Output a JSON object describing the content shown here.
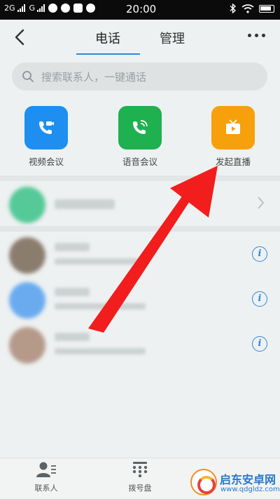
{
  "status_bar": {
    "network1": "2G",
    "network2": "G",
    "time": "20:00"
  },
  "header": {
    "tabs": [
      {
        "label": "电话",
        "active": true
      },
      {
        "label": "管理",
        "active": false
      }
    ],
    "accent_color": "#2c88d8"
  },
  "search": {
    "placeholder": "搜索联系人，一键通话"
  },
  "quick_actions": [
    {
      "label": "视频会议",
      "icon": "video-call-icon",
      "color": "#1e8ff0"
    },
    {
      "label": "语音会议",
      "icon": "voice-call-icon",
      "color": "#1fb04f"
    },
    {
      "label": "发起直播",
      "icon": "live-tv-icon",
      "color": "#f6a00c"
    }
  ],
  "list": {
    "rows": [
      {
        "avatar_color": "#55c997",
        "trailing": "chevron-right-icon"
      },
      {
        "avatar_color": "#8b7d6e",
        "trailing": "info-icon"
      },
      {
        "avatar_color": "#6aabf0",
        "trailing": "info-icon"
      },
      {
        "avatar_color": "#b59a8a",
        "trailing": "info-icon"
      }
    ]
  },
  "bottom_nav": [
    {
      "label": "联系人",
      "icon": "contacts-icon"
    },
    {
      "label": "拨号盘",
      "icon": "dialpad-icon"
    }
  ],
  "watermark": {
    "title": "启东安卓网",
    "url": "www.qdgldz.com"
  },
  "annotation": {
    "color": "#f21d1d"
  }
}
